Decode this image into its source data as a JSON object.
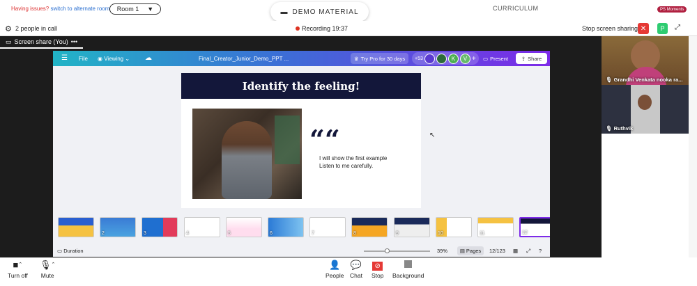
{
  "top": {
    "issue_text": "Having issues?",
    "issue_link": "switch to alternate room",
    "room": "Room 1",
    "demo": "DEMO MATERIAL",
    "curriculum": "CURRICULUM",
    "moments": "PS Moments"
  },
  "call": {
    "people": "2 people in call",
    "recording": "Recording 19:37",
    "stop_sharing": "Stop screen sharing",
    "p_badge": "P"
  },
  "screen_tab": "Screen share (You)",
  "canva": {
    "file": "File",
    "viewing": "Viewing",
    "doc_title": "Final_Creator_Junior_Demo_PPT ...",
    "try_pro": "Try Pro for 30 days",
    "more_count": "+53",
    "avatars": [
      "K",
      "V"
    ],
    "present": "Present",
    "share": "Share",
    "slide_title": "Identify the feeling!",
    "quote_mark": "““",
    "slide_text_1": "I will show the first example",
    "slide_text_2": "Listen to me carefully.",
    "thumb_numbers": [
      "2",
      "3",
      "4",
      "5",
      "6",
      "7",
      "8",
      "9",
      "10",
      "11",
      "12"
    ],
    "duration": "Duration",
    "zoom": "39%",
    "pages_label": "Pages",
    "page_count": "12/123"
  },
  "participants": [
    {
      "name": "Grandhi Venkata nooka ra..."
    },
    {
      "name": "Ruthvik"
    }
  ],
  "controls": {
    "camera": "Turn off",
    "mute": "Mute",
    "people": "People",
    "chat": "Chat",
    "stop": "Stop",
    "background": "Background"
  },
  "colors": {
    "recording_dot": "#d32f2f",
    "stop_sharing_x": "#e53935",
    "canva_gradient": [
      "#22b4c6",
      "#3b6fd6",
      "#7d2ae8"
    ],
    "slide_header": "#13173a"
  }
}
